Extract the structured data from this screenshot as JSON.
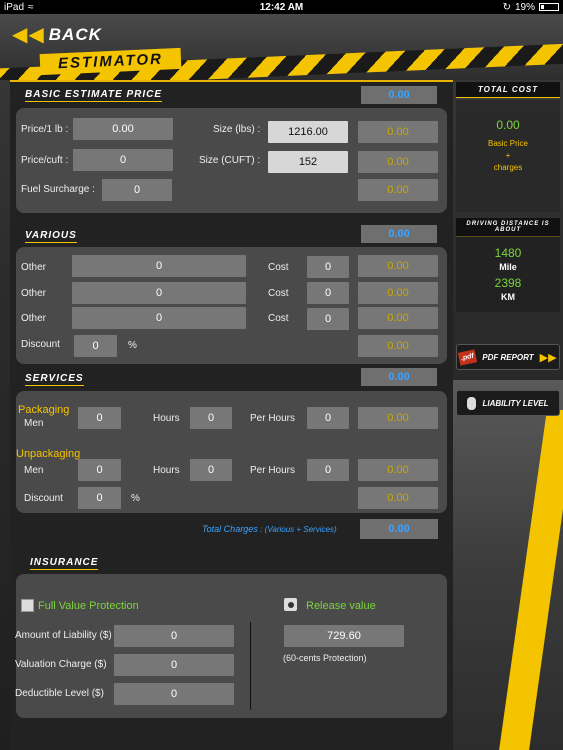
{
  "status": {
    "device": "iPad",
    "time": "12:42 AM",
    "battery": "19%"
  },
  "header": {
    "back_label": "BACK",
    "title": "ESTIMATOR"
  },
  "basic": {
    "title": "BASIC ESTIMATE PRICE",
    "total": "0.00",
    "price_lb_label": "Price/1 lb :",
    "price_lb": "0.00",
    "size_lbs_label": "Size (lbs) :",
    "size_lbs": "1216.00",
    "size_lbs_total": "0.00",
    "price_cuft_label": "Price/cuft :",
    "price_cuft": "0",
    "size_cuft_label": "Size (CUFT) :",
    "size_cuft": "152",
    "size_cuft_total": "0.00",
    "fuel_label": "Fuel Surcharge :",
    "fuel": "0",
    "fuel_total": "0.00"
  },
  "various": {
    "title": "VARIOUS",
    "total": "0.00",
    "rows": [
      {
        "label": "Other",
        "value": "0",
        "cost_label": "Cost",
        "cost": "0",
        "total": "0.00"
      },
      {
        "label": "Other",
        "value": "0",
        "cost_label": "Cost",
        "cost": "0",
        "total": "0.00"
      },
      {
        "label": "Other",
        "value": "0",
        "cost_label": "Cost",
        "cost": "0",
        "total": "0.00"
      }
    ],
    "discount_label": "Discount",
    "discount": "0",
    "discount_unit": "%",
    "discount_total": "0.00"
  },
  "services": {
    "title": "SERVICES",
    "total": "0.00",
    "packaging_label": "Packaging",
    "men_label": "Men",
    "pack_men": "0",
    "hours_label": "Hours",
    "pack_hours": "0",
    "per_hours_label": "Per Hours",
    "pack_per_hours": "0",
    "pack_total": "0.00",
    "unpackaging_label": "Unpackaging",
    "unpack_men": "0",
    "unpack_hours": "0",
    "unpack_per_hours": "0",
    "unpack_total": "0.00",
    "discount_label": "Discount",
    "discount": "0",
    "discount_unit": "%",
    "discount_total": "0.00"
  },
  "total_charges": {
    "label": "Total Charges",
    "note": ": (Various + Services)",
    "value": "0.00"
  },
  "insurance": {
    "title": "INSURANCE",
    "full_value_label": "Full Value Protection",
    "release_value_label": "Release value",
    "liability_label": "Amount of Liability ($)",
    "liability": "0",
    "valuation_label": "Valuation Charge  ($)",
    "valuation": "0",
    "deductible_label": "Deductible Level ($)",
    "deductible": "0",
    "release_amount": "729.60",
    "release_note": "(60-cents Protection)"
  },
  "side": {
    "total_cost_title": "TOTAL COST",
    "total_cost": "0.00",
    "basic_price_line1": "Basic Price",
    "basic_price_line2": "+",
    "basic_price_line3": "charges",
    "distance_title": "DRIVING DISTANCE IS ABOUT",
    "miles": "1480",
    "miles_unit": "Mile",
    "km": "2398",
    "km_unit": "KM",
    "pdf_label": "PDF REPORT",
    "pdf_badge": ".pdf",
    "liability_btn": "LIABILITY LEVEL"
  },
  "colors": {
    "accent": "#f5c400",
    "blue": "#3aa4ff",
    "green": "#7cd43b"
  }
}
